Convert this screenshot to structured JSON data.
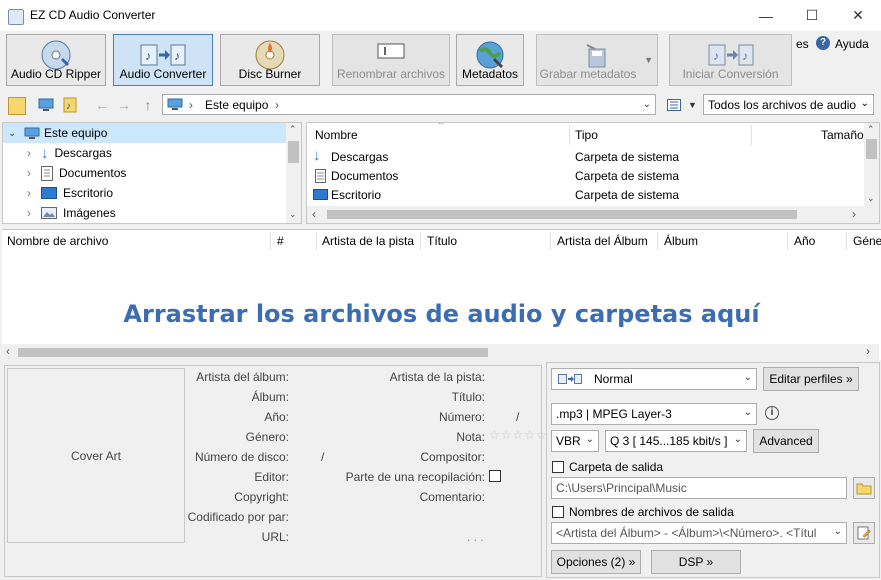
{
  "window": {
    "title": "EZ CD Audio Converter",
    "minimize": "—",
    "maximize": "☐",
    "close": "✕"
  },
  "ribbon": {
    "audio_cd_ripper": "Audio CD Ripper",
    "audio_converter": "Audio Converter",
    "disc_burner": "Disc Burner",
    "rename_files": "Renombrar archivos",
    "metadata": "Metadatos",
    "save_metadata": "Grabar metadatos",
    "start_conversion": "Iniciar Conversión",
    "options_truncated": "es",
    "help": "Ayuda"
  },
  "navbar": {
    "address": "Este equipo",
    "filter": "Todos los archivos de audio"
  },
  "tree": [
    {
      "label": "Este equipo",
      "expanded": true,
      "selected": true,
      "icon": "computer-icon"
    },
    {
      "label": "Descargas",
      "icon": "downloads-icon"
    },
    {
      "label": "Documentos",
      "icon": "documents-icon"
    },
    {
      "label": "Escritorio",
      "icon": "desktop-icon"
    },
    {
      "label": "Imágenes",
      "icon": "pictures-icon"
    }
  ],
  "files": {
    "columns": {
      "name": "Nombre",
      "type": "Tipo",
      "size": "Tamaño"
    },
    "rows": [
      {
        "name": "Descargas",
        "type": "Carpeta de sistema",
        "icon": "downloads-icon"
      },
      {
        "name": "Documentos",
        "type": "Carpeta de sistema",
        "icon": "documents-icon"
      },
      {
        "name": "Escritorio",
        "type": "Carpeta de sistema",
        "icon": "desktop-icon"
      }
    ]
  },
  "tracks": {
    "columns": {
      "filename": "Nombre de archivo",
      "number": "#",
      "track_artist": "Artista de la pista",
      "title": "Título",
      "album_artist": "Artista del Álbum",
      "album": "Álbum",
      "year": "Año",
      "genre": "Géne"
    },
    "drop_hint": "Arrastrar los archivos de audio y carpetas aquí"
  },
  "meta": {
    "cover_art": "Cover Art",
    "album_artist": "Artista del álbum:",
    "album": "Álbum:",
    "year": "Año:",
    "genre": "Género:",
    "disc_number": "Número de disco:",
    "disc_sep": "/",
    "publisher": "Editor:",
    "copyright": "Copyright:",
    "encoded_by": "Codificado por par:",
    "url": "URL:",
    "track_artist": "Artista de la pista:",
    "title": "Título:",
    "number": "Número:",
    "number_sep": "/",
    "rating": "Nota:",
    "composer": "Compositor:",
    "compilation": "Parte de una recopilación:",
    "comment": "Comentario:",
    "ellipsis": ". . ."
  },
  "output": {
    "profile": "Normal",
    "edit_profiles": "Editar perfiles »",
    "format": ".mp3 | MPEG Layer-3",
    "mode": "VBR",
    "quality": "Q 3  [ 145...185 kbit/s ]",
    "advanced": "Advanced",
    "output_folder_label": "Carpeta de salida",
    "output_folder": "C:\\Users\\Principal\\Music",
    "filenames_label": "Nombres de archivos de salida",
    "filename_pattern": "<Artista del Álbum> - <Álbum>\\<Número>. <Títul",
    "options": "Opciones (2) »",
    "dsp": "DSP »"
  },
  "colors": {
    "accent": "#3b6db3",
    "selection": "#cce8ff"
  }
}
